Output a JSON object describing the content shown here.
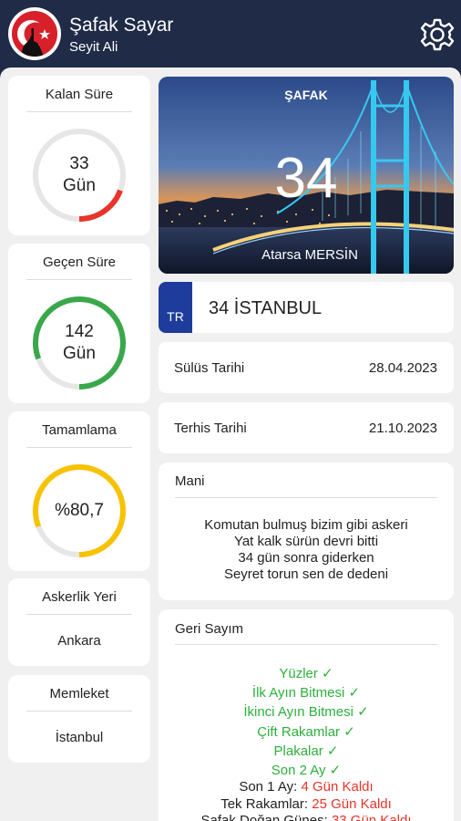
{
  "header": {
    "title": "Şafak Sayar",
    "subtitle": "Seyit Ali"
  },
  "colors": {
    "header_bg": "#1f2b47",
    "remaining_ring": "#e8342a",
    "elapsed_ring": "#3aa84a",
    "completion_ring": "#f7c200",
    "done_green": "#2eaf3c",
    "pending_red": "#e8342a",
    "plate_blue": "#1e3c9c"
  },
  "left": {
    "remaining": {
      "title": "Kalan Süre",
      "value": "33",
      "unit": "Gün",
      "fraction": 0.193
    },
    "elapsed": {
      "title": "Geçen Süre",
      "value": "142",
      "unit": "Gün",
      "fraction": 0.807
    },
    "completion": {
      "title": "Tamamlama",
      "value": "%80,7",
      "fraction": 0.807
    },
    "location": {
      "title": "Askerlik Yeri",
      "value": "Ankara"
    },
    "hometown": {
      "title": "Memleket",
      "value": "İstanbul"
    }
  },
  "hero": {
    "label": "ŞAFAK",
    "number": "34",
    "city": "Atarsa MERSİN"
  },
  "plate": {
    "country": "TR",
    "text": "34 İSTANBUL"
  },
  "dates": {
    "sulus": {
      "label": "Sülüs Tarihi",
      "value": "28.04.2023"
    },
    "terhis": {
      "label": "Terhis Tarihi",
      "value": "21.10.2023"
    }
  },
  "mani": {
    "title": "Mani",
    "lines": [
      "Komutan bulmuş bizim gibi askeri",
      "Yat kalk sürün devri bitti",
      "34 gün sonra giderken",
      "Seyret torun sen de dedeni"
    ]
  },
  "countdown": {
    "title": "Geri Sayım",
    "done": [
      "Yüzler ✓",
      "İlk Ayın Bitmesi ✓",
      "İkinci Ayın Bitmesi ✓",
      "Çift Rakamlar ✓",
      "Plakalar ✓",
      "Son 2 Ay ✓"
    ],
    "pending": [
      {
        "label": "Son 1 Ay: ",
        "value": "4 Gün Kaldı"
      },
      {
        "label": "Tek Rakamlar: ",
        "value": "25 Gün Kaldı"
      },
      {
        "label": "Şafak Doğan Güneş: ",
        "value": "33 Gün Kaldı"
      }
    ]
  }
}
